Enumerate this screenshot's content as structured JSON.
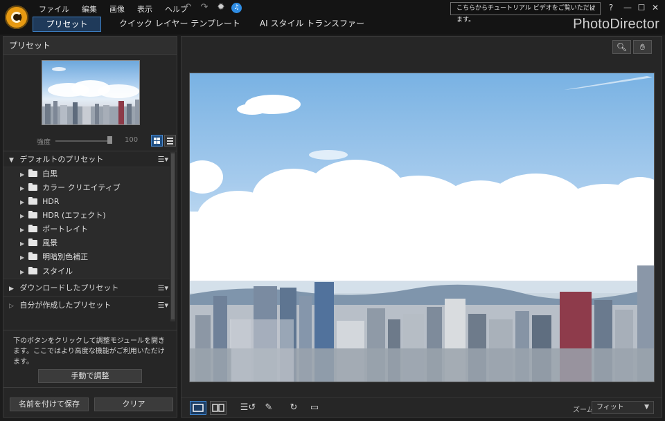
{
  "menu": [
    "ファイル",
    "編集",
    "画像",
    "表示",
    "ヘルプ"
  ],
  "menu_icons": [
    "undo-icon",
    "redo-icon",
    "settings-icon",
    "notification-icon"
  ],
  "tooltip": {
    "text": "こちらからチュートリアル ビデオをご覧いただけます。",
    "close": "×"
  },
  "window": {
    "help": "?",
    "minimize": "—",
    "maximize": "☐",
    "close": "✕"
  },
  "tabs": [
    {
      "label": "プリセット",
      "active": true
    },
    {
      "label": "クイック レイヤー テンプレート",
      "active": false
    },
    {
      "label": "AI スタイル トランスファー",
      "active": false
    }
  ],
  "brand": "PhotoDirector",
  "left": {
    "title": "プリセット",
    "strength_label": "強度",
    "strength_value": "100",
    "strength_level": 1.0,
    "tree": {
      "default": {
        "label": "デフォルトのプリセット",
        "expanded": true
      },
      "children": [
        "白黒",
        "カラー クリエイティブ",
        "HDR",
        "HDR (エフェクト)",
        "ポートレイト",
        "風景",
        "明暗別色補正",
        "スタイル"
      ],
      "downloaded": {
        "label": "ダウンロードしたプリセット"
      },
      "mine": {
        "label": "自分が作成したプリセット"
      }
    },
    "info_text": "下のボタンをクリックして調整モジュールを開きます。ここではより高度な機能がご利用いただけます。",
    "manual_button": "手動で調整",
    "save_button": "名前を付けて保存",
    "clear_button": "クリア"
  },
  "viewer": {
    "zoom_label": "ズーム:",
    "zoom_value": "フィット"
  },
  "colors": {
    "accent": "#3d7fc4",
    "accent_bg": "#1f3a5a",
    "panel": "#262626",
    "notification": "#2f8de4"
  }
}
